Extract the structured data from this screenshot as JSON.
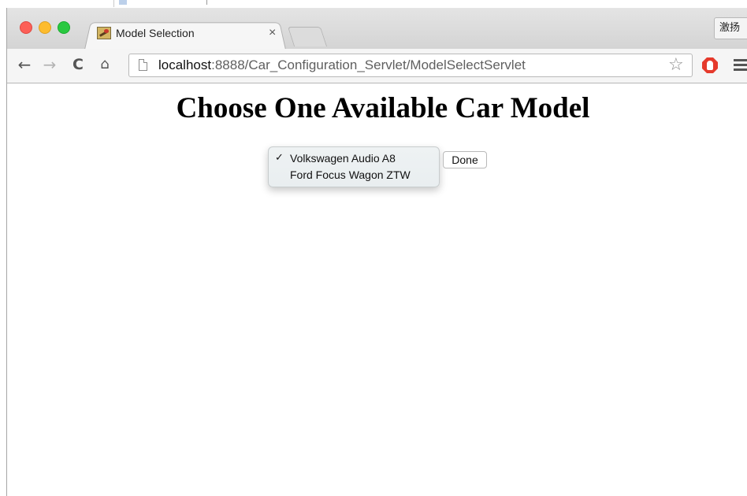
{
  "browser": {
    "tab": {
      "title": "Model Selection",
      "close_glyph": "×"
    },
    "profile_label": "激扬",
    "address_bar": {
      "host": "localhost",
      "path": ":8888/Car_Configuration_Servlet/ModelSelectServlet"
    },
    "icons": {
      "back": "←",
      "forward": "→",
      "reload": "C",
      "home": "⌂",
      "bookmark_star": "☆"
    }
  },
  "page": {
    "heading": "Choose One Available Car Model",
    "model_select": {
      "options": [
        {
          "label": "Volkswagen Audio A8",
          "selected": true,
          "check": "✓"
        },
        {
          "label": "Ford Focus Wagon ZTW",
          "selected": false,
          "check": ""
        }
      ]
    },
    "done_label": "Done"
  }
}
